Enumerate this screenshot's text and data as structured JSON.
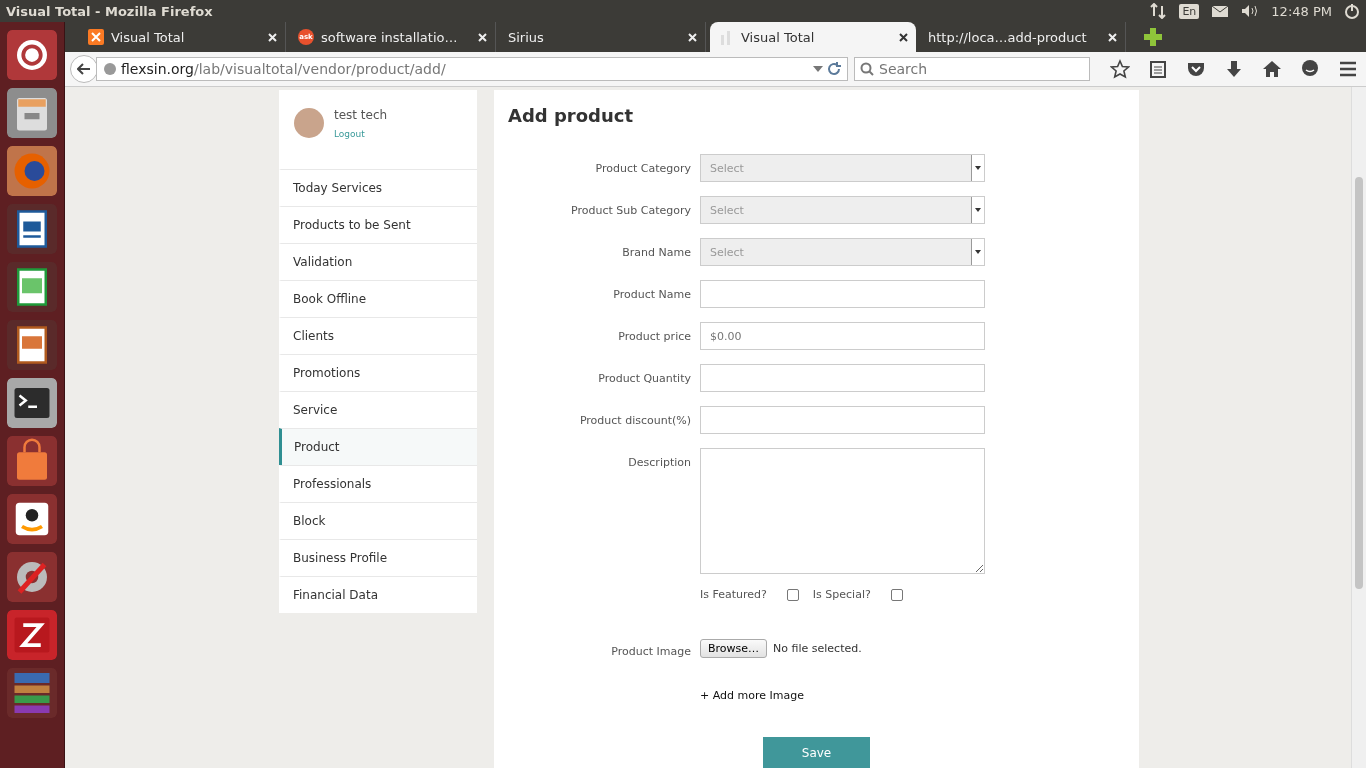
{
  "top_panel": {
    "title": "Visual Total - Mozilla Firefox",
    "keyboard": "En",
    "clock": "12:48 PM"
  },
  "tabs": [
    {
      "label": "Visual Total",
      "favicon": {
        "kind": "square"
      },
      "selected": false
    },
    {
      "label": "software installatio…",
      "favicon": {
        "kind": "badge",
        "text": "ask"
      },
      "selected": false
    },
    {
      "label": "Sirius",
      "selected": false
    },
    {
      "label": "Visual Total",
      "favicon": {
        "kind": "bars"
      },
      "selected": true
    },
    {
      "label": "http://loca…add-product",
      "selected": false
    }
  ],
  "address_bar": {
    "domain": "flexsin.org",
    "path": "/lab/visualtotal/vendor/product/add/"
  },
  "search": {
    "placeholder": "Search"
  },
  "user": {
    "name": "test tech",
    "logout": "Logout"
  },
  "sidebar": {
    "items": [
      {
        "label": "Today Services",
        "selected": false
      },
      {
        "label": "Products to be Sent",
        "selected": false
      },
      {
        "label": "Validation",
        "selected": false
      },
      {
        "label": "Book Offline",
        "selected": false
      },
      {
        "label": "Clients",
        "selected": false
      },
      {
        "label": "Promotions",
        "selected": false
      },
      {
        "label": "Service",
        "selected": false
      },
      {
        "label": "Product",
        "selected": true
      },
      {
        "label": "Professionals",
        "selected": false
      },
      {
        "label": "Block",
        "selected": false
      },
      {
        "label": "Business Profile",
        "selected": false
      },
      {
        "label": "Financial Data",
        "selected": false
      }
    ]
  },
  "form": {
    "title": "Add product",
    "fields": [
      {
        "label": "Product Category",
        "kind": "select",
        "value": "Select"
      },
      {
        "label": "Product Sub Category",
        "kind": "select",
        "value": "Select"
      },
      {
        "label": "Brand Name",
        "kind": "select",
        "value": "Select"
      },
      {
        "label": "Product Name",
        "kind": "text"
      },
      {
        "label": "Product price",
        "kind": "text",
        "placeholder": "$0.00"
      },
      {
        "label": "Product Quantity",
        "kind": "text"
      },
      {
        "label": "Product discount(%)",
        "kind": "text"
      },
      {
        "label": "Description",
        "kind": "textarea"
      }
    ],
    "checkboxes": [
      {
        "label": "Is Featured?",
        "checked": false
      },
      {
        "label": "Is Special?",
        "checked": false
      }
    ],
    "image": {
      "label": "Product Image",
      "button": "Browse…",
      "status": "No file selected."
    },
    "add_more": "+ Add more Image",
    "save": "Save"
  }
}
